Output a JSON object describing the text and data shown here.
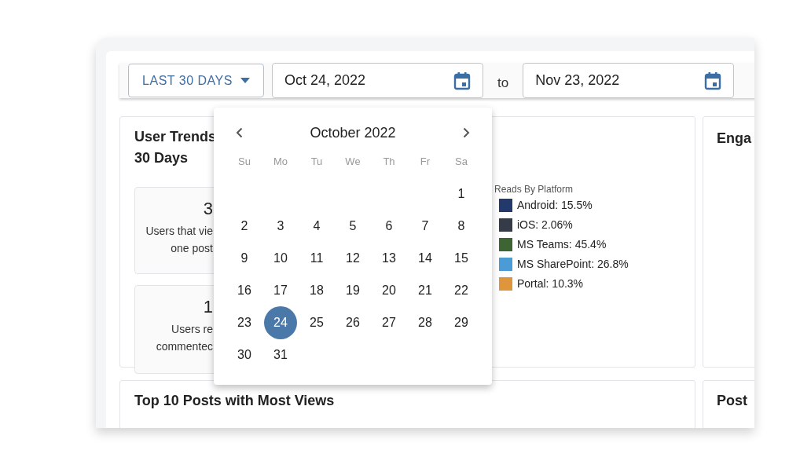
{
  "toolbar": {
    "range_button": "LAST 30 DAYS",
    "from_date": "Oct 24, 2022",
    "separator": "to",
    "to_date": "Nov 23, 2022"
  },
  "user_trends": {
    "title": "User Trends",
    "title_line_2": "30 Days",
    "stats": [
      {
        "value": "3",
        "caption": "Users that vie",
        "caption_line_2": "one post"
      },
      {
        "value": "1",
        "caption": "Users re",
        "caption_line_2": "commentec"
      }
    ]
  },
  "legend": {
    "title": "Reads By Platform",
    "items": [
      {
        "label": "Android: 15.5%",
        "color": "#213a6b"
      },
      {
        "label": "iOS: 2.06%",
        "color": "#353c47"
      },
      {
        "label": "MS Teams: 45.4%",
        "color": "#3f6433"
      },
      {
        "label": "MS SharePoint: 26.8%",
        "color": "#4a9bd6"
      },
      {
        "label": "Portal: 10.3%",
        "color": "#de953b"
      }
    ]
  },
  "engagement_panel": {
    "title": "Enga"
  },
  "top_posts_panel": {
    "title": "Top 10 Posts with Most Views"
  },
  "posts_panel": {
    "title": "Post"
  },
  "calendar": {
    "month": "October 2022",
    "weekdays": [
      "Su",
      "Mo",
      "Tu",
      "We",
      "Th",
      "Fr",
      "Sa"
    ],
    "weeks": [
      {
        "leading_gap": true,
        "days": [
          {
            "label": "1",
            "selected": false
          }
        ]
      },
      {
        "leading_gap": false,
        "days": [
          {
            "label": "2",
            "selected": false
          },
          {
            "label": "3",
            "selected": false
          },
          {
            "label": "4",
            "selected": false
          },
          {
            "label": "5",
            "selected": false
          },
          {
            "label": "6",
            "selected": false
          },
          {
            "label": "7",
            "selected": false
          },
          {
            "label": "8",
            "selected": false
          }
        ]
      },
      {
        "leading_gap": false,
        "days": [
          {
            "label": "9",
            "selected": false
          },
          {
            "label": "10",
            "selected": false
          },
          {
            "label": "11",
            "selected": false
          },
          {
            "label": "12",
            "selected": false
          },
          {
            "label": "13",
            "selected": false
          },
          {
            "label": "14",
            "selected": false
          },
          {
            "label": "15",
            "selected": false
          }
        ]
      },
      {
        "leading_gap": false,
        "days": [
          {
            "label": "16",
            "selected": false
          },
          {
            "label": "17",
            "selected": false
          },
          {
            "label": "18",
            "selected": false
          },
          {
            "label": "19",
            "selected": false
          },
          {
            "label": "20",
            "selected": false
          },
          {
            "label": "21",
            "selected": false
          },
          {
            "label": "22",
            "selected": false
          }
        ]
      },
      {
        "leading_gap": false,
        "days": [
          {
            "label": "23",
            "selected": false
          },
          {
            "label": "24",
            "selected": true
          },
          {
            "label": "25",
            "selected": false
          },
          {
            "label": "26",
            "selected": false
          },
          {
            "label": "27",
            "selected": false
          },
          {
            "label": "28",
            "selected": false
          },
          {
            "label": "29",
            "selected": false
          }
        ]
      },
      {
        "leading_gap": false,
        "days": [
          {
            "label": "30",
            "selected": false
          },
          {
            "label": "31",
            "selected": false
          }
        ]
      }
    ]
  }
}
